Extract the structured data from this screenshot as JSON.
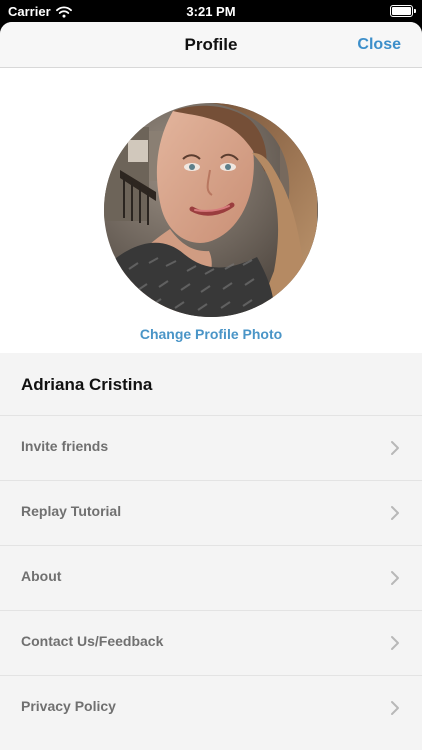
{
  "status_bar": {
    "carrier": "Carrier",
    "time": "3:21 PM"
  },
  "nav": {
    "title": "Profile",
    "close_label": "Close",
    "accent_color": "#3d8fca"
  },
  "profile": {
    "change_photo_label": "Change Profile Photo",
    "name": "Adriana Cristina"
  },
  "menu": [
    {
      "label": "Invite friends",
      "icon": "chevron-right-icon"
    },
    {
      "label": "Replay Tutorial",
      "icon": "chevron-right-icon"
    },
    {
      "label": "About",
      "icon": "chevron-right-icon"
    },
    {
      "label": "Contact Us/Feedback",
      "icon": "chevron-right-icon"
    },
    {
      "label": "Privacy Policy",
      "icon": "chevron-right-icon"
    }
  ]
}
